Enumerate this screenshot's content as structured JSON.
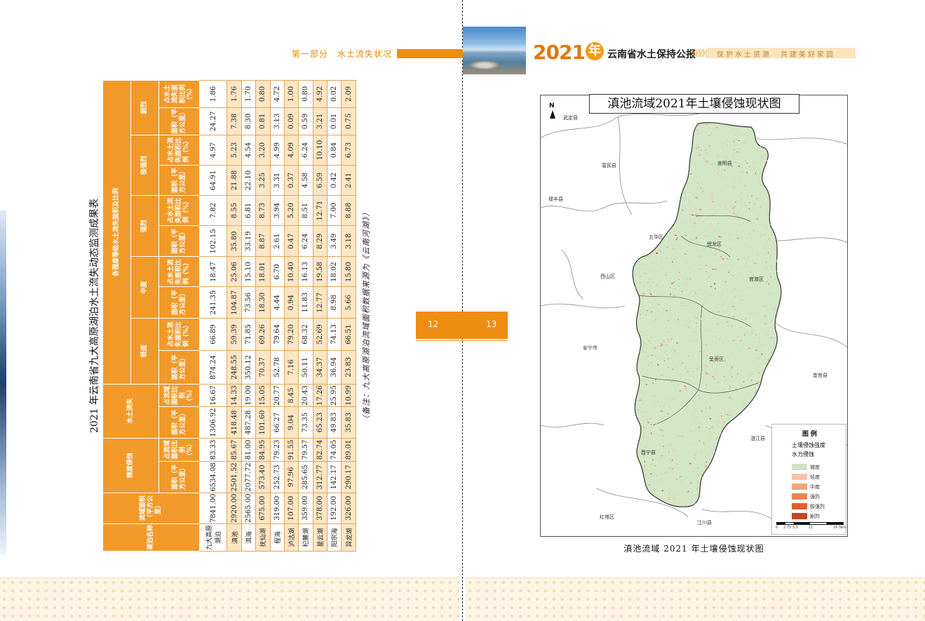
{
  "header": {
    "left_section": "第一部分　水土流失状况",
    "year": "2021",
    "year_suffix": "年",
    "report_title": "云南省水土保持公报",
    "arrows": "》》》》》",
    "slogan": "保护水土资源　共建美好家园"
  },
  "page_numbers": {
    "left": "12",
    "right": "13"
  },
  "table": {
    "title": "2021 年云南省九大高原湖泊水土流失动态监测成果表",
    "note": "（备注：九大高原湖泊流域面积数据来源为《云南河湖》）",
    "headers": {
      "lake_name": "湖泊名称",
      "basin_area": "流域面积（平方公里）",
      "slight": "微度侵蚀",
      "loss": "水土流失",
      "grades": "各强度等级水土流失面积及比例",
      "light": "轻度",
      "moderate": "中度",
      "strong": "强烈",
      "very_strong": "极强烈",
      "severe": "剧烈",
      "area": "面积（平方公里）",
      "pct_basin": "占流域面积比例（%）",
      "pct_loss": "占水土流失面积比例（%）"
    },
    "rows": [
      {
        "name": "九大高原湖泊",
        "basin": "7841.00",
        "slight_area": "6534.08",
        "slight_pct": "83.33",
        "loss_area": "1306.92",
        "loss_pct": "16.67",
        "l_area": "874.24",
        "l_pct": "66.89",
        "m_area": "241.35",
        "m_pct": "18.47",
        "s_area": "102.15",
        "s_pct": "7.82",
        "vs_area": "64.91",
        "vs_pct": "4.97",
        "sv_area": "24.27",
        "sv_pct": "1.86"
      },
      {
        "name": "滇池",
        "basin": "2920.00",
        "slight_area": "2501.52",
        "slight_pct": "85.67",
        "loss_area": "418.48",
        "loss_pct": "14.33",
        "l_area": "248.55",
        "l_pct": "59.39",
        "m_area": "104.87",
        "m_pct": "25.06",
        "s_area": "35.80",
        "s_pct": "8.55",
        "vs_area": "21.88",
        "vs_pct": "5.23",
        "sv_area": "7.38",
        "sv_pct": "1.76"
      },
      {
        "name": "洱海",
        "basin": "2565.00",
        "slight_area": "2077.72",
        "slight_pct": "81.00",
        "loss_area": "487.28",
        "loss_pct": "19.00",
        "l_area": "350.12",
        "l_pct": "71.85",
        "m_area": "73.56",
        "m_pct": "15.10",
        "s_area": "33.19",
        "s_pct": "6.81",
        "vs_area": "22.10",
        "vs_pct": "4.54",
        "sv_area": "8.30",
        "sv_pct": "1.70"
      },
      {
        "name": "抚仙湖",
        "basin": "675.00",
        "slight_area": "573.40",
        "slight_pct": "84.95",
        "loss_area": "101.60",
        "loss_pct": "15.05",
        "l_area": "70.37",
        "l_pct": "69.26",
        "m_area": "18.30",
        "m_pct": "18.01",
        "s_area": "8.87",
        "s_pct": "8.73",
        "vs_area": "3.25",
        "vs_pct": "3.20",
        "sv_area": "0.81",
        "sv_pct": "0.80"
      },
      {
        "name": "程海",
        "basin": "319.00",
        "slight_area": "252.73",
        "slight_pct": "79.23",
        "loss_area": "66.27",
        "loss_pct": "20.77",
        "l_area": "52.78",
        "l_pct": "79.64",
        "m_area": "4.44",
        "m_pct": "6.70",
        "s_area": "2.61",
        "s_pct": "3.94",
        "vs_area": "3.31",
        "vs_pct": "4.99",
        "sv_area": "3.13",
        "sv_pct": "4.72"
      },
      {
        "name": "泸沽湖",
        "basin": "107.00",
        "slight_area": "97.96",
        "slight_pct": "91.55",
        "loss_area": "9.04",
        "loss_pct": "8.45",
        "l_area": "7.16",
        "l_pct": "79.20",
        "m_area": "0.94",
        "m_pct": "10.40",
        "s_area": "0.47",
        "s_pct": "5.20",
        "vs_area": "0.37",
        "vs_pct": "4.09",
        "sv_area": "0.09",
        "sv_pct": "1.00"
      },
      {
        "name": "杞麓湖",
        "basin": "359.00",
        "slight_area": "285.65",
        "slight_pct": "79.57",
        "loss_area": "73.35",
        "loss_pct": "20.43",
        "l_area": "50.11",
        "l_pct": "68.32",
        "m_area": "11.83",
        "m_pct": "16.13",
        "s_area": "6.24",
        "s_pct": "8.51",
        "vs_area": "4.58",
        "vs_pct": "6.24",
        "sv_area": "0.59",
        "sv_pct": "0.80"
      },
      {
        "name": "星云湖",
        "basin": "378.00",
        "slight_area": "312.77",
        "slight_pct": "82.74",
        "loss_area": "65.23",
        "loss_pct": "17.26",
        "l_area": "34.37",
        "l_pct": "52.69",
        "m_area": "12.77",
        "m_pct": "19.58",
        "s_area": "8.29",
        "s_pct": "12.71",
        "vs_area": "6.59",
        "vs_pct": "10.10",
        "sv_area": "3.21",
        "sv_pct": "4.92"
      },
      {
        "name": "阳宗海",
        "basin": "192.00",
        "slight_area": "142.17",
        "slight_pct": "74.05",
        "loss_area": "49.83",
        "loss_pct": "25.95",
        "l_area": "36.94",
        "l_pct": "74.13",
        "m_area": "8.98",
        "m_pct": "18.02",
        "s_area": "3.49",
        "s_pct": "7.00",
        "vs_area": "0.42",
        "vs_pct": "0.84",
        "sv_area": "0.01",
        "sv_pct": "0.02"
      },
      {
        "name": "异龙湖",
        "basin": "326.00",
        "slight_area": "290.17",
        "slight_pct": "89.01",
        "loss_area": "35.83",
        "loss_pct": "10.99",
        "l_area": "23.83",
        "l_pct": "66.51",
        "m_area": "5.66",
        "m_pct": "15.80",
        "s_area": "3.18",
        "s_pct": "8.88",
        "vs_area": "2.41",
        "vs_pct": "6.73",
        "sv_area": "0.75",
        "sv_pct": "2.09"
      }
    ]
  },
  "map": {
    "title": "滇池流域2021年土壤侵蚀现状图",
    "caption": "滇池流域 2021 年土壤侵蚀现状图",
    "north": "N",
    "places": {
      "wuding": "武定县",
      "songming": "嵩明县",
      "fumin": "富民县",
      "lufeng": "禄丰县",
      "wuhua": "五华区",
      "panlong": "盘龙区",
      "xishan": "西山区",
      "guandu": "官渡区",
      "anning": "安宁市",
      "chenggong": "呈贡区",
      "yiliang": "宜良县",
      "jinning": "晋宁县",
      "chengjiang": "澄江县",
      "hongta": "红塔区",
      "jiangchuan": "江川县"
    },
    "legend": {
      "title": "图 例",
      "sub1": "土壤侵蚀强度",
      "sub2": "水力侵蚀",
      "items": [
        {
          "label": "微度",
          "color": "#cfe3c2"
        },
        {
          "label": "轻度",
          "color": "#f6c4a8"
        },
        {
          "label": "中度",
          "color": "#f1a57f"
        },
        {
          "label": "强烈",
          "color": "#ec8258"
        },
        {
          "label": "极强烈",
          "color": "#e0602e"
        },
        {
          "label": "剧烈",
          "color": "#c8461e"
        }
      ]
    },
    "scale": {
      "t0": "0",
      "t1": "2.75",
      "t2": "5.5",
      "t3": "11",
      "t4": "16.5",
      "unit": "km"
    },
    "colors": {
      "basin_fill": "#d3e6c6",
      "boundary": "#555555"
    }
  }
}
